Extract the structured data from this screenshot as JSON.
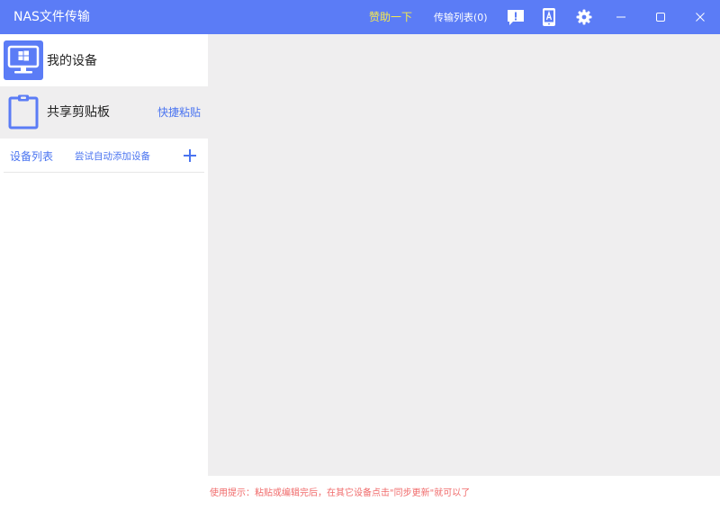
{
  "window": {
    "title": "NAS文件传输",
    "donate_label": "赞助一下",
    "transfer_list_label": "传输列表(0)",
    "icons": [
      "feedback-icon",
      "phone-icon",
      "settings-icon",
      "minimize-icon",
      "maximize-icon",
      "close-icon"
    ]
  },
  "sidebar": {
    "my_devices_label": "我的设备",
    "shared_clipboard_label": "共享剪贴板",
    "quick_paste_label": "快捷粘贴",
    "device_list_title": "设备列表",
    "auto_add_label": "尝试自动添加设备"
  },
  "footer": {
    "hint": "使用提示：粘贴或编辑完后，在其它设备点击\"同步更新\"就可以了"
  },
  "colors": {
    "accent": "#5b7cf6",
    "link": "#4a74f0",
    "donate": "#f6ea4c",
    "hint": "#f06a6a",
    "panel_bg": "#efeeef"
  }
}
